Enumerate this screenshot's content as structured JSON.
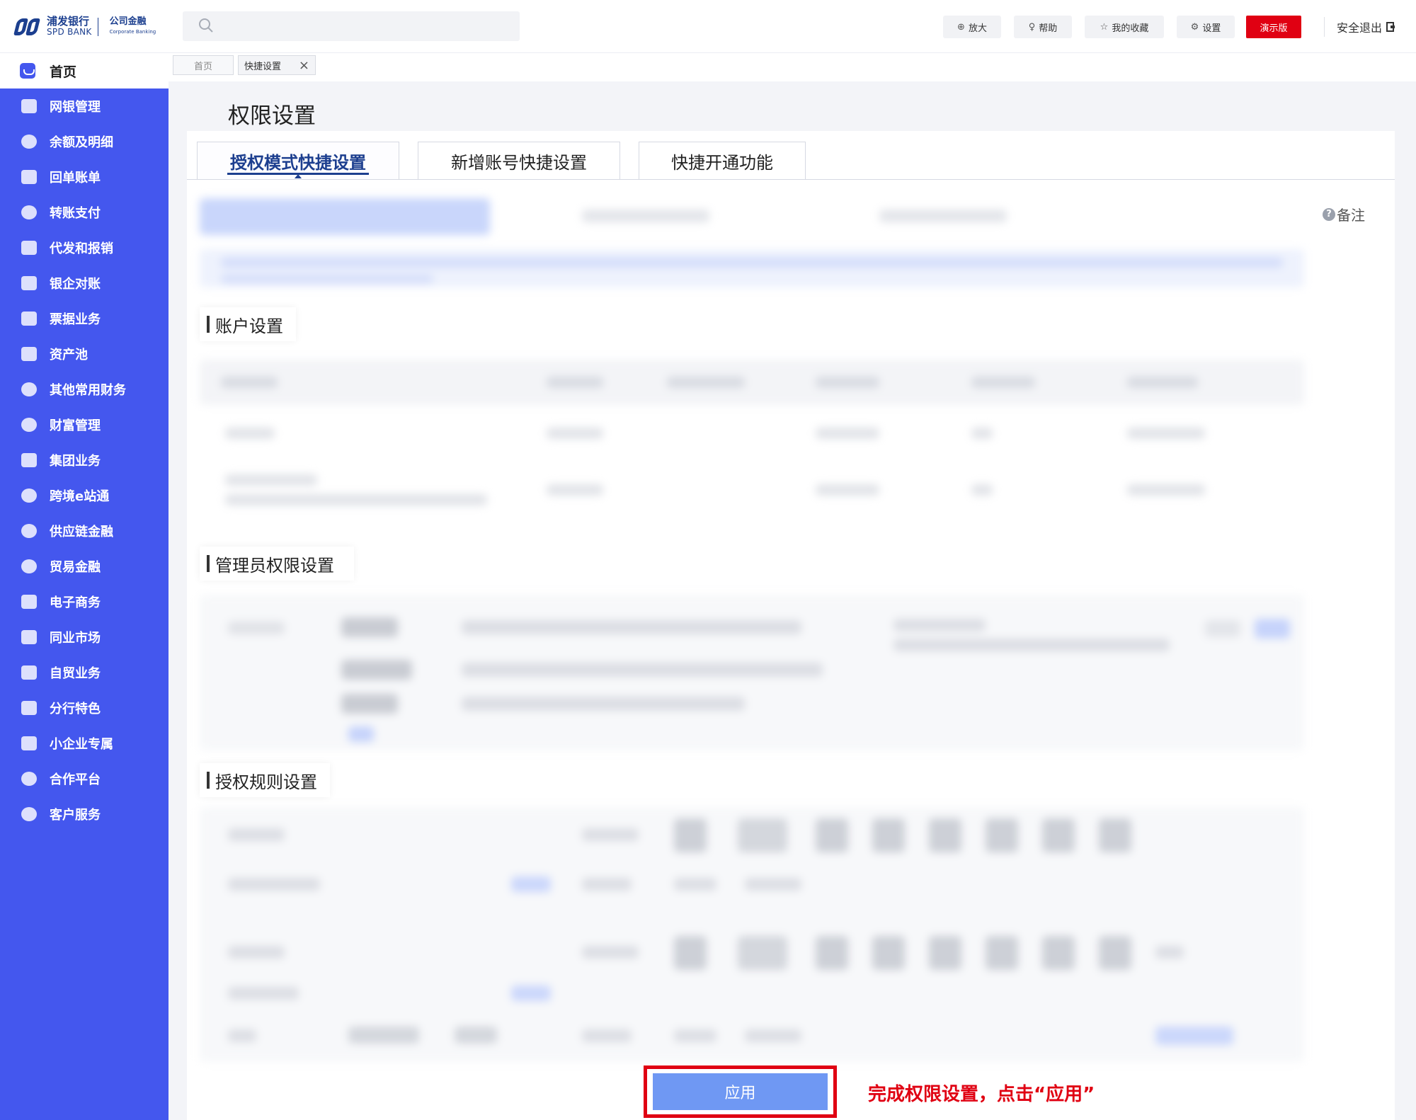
{
  "header": {
    "logo_cn": "浦发银行",
    "logo_en": "SPD BANK",
    "logo_sub_cn": "公司金融",
    "logo_sub_en": "Corporate Banking",
    "search_placeholder": "",
    "tools": [
      {
        "label": "放大",
        "icon": "zoom-in-icon"
      },
      {
        "label": "帮助",
        "icon": "lightbulb-icon"
      },
      {
        "label": "我的收藏",
        "icon": "star-icon"
      },
      {
        "label": "设置",
        "icon": "gear-icon"
      }
    ],
    "demo_label": "演示版",
    "logout_label": "安全退出",
    "demo_color": "#e00012"
  },
  "sidebar": {
    "home_label": "首页",
    "accent": "#4457ee",
    "items": [
      "网银管理",
      "余额及明细",
      "回单账单",
      "转账支付",
      "代发和报销",
      "银企对账",
      "票据业务",
      "资产池",
      "其他常用财务",
      "财富管理",
      "集团业务",
      "跨境e站通",
      "供应链金融",
      "贸易金融",
      "电子商务",
      "同业市场",
      "自贸业务",
      "分行特色",
      "小企业专属",
      "合作平台",
      "客户服务"
    ]
  },
  "breadcrumbs": {
    "home": "首页",
    "active": "快捷设置"
  },
  "main": {
    "title": "权限设置",
    "tabs": [
      "授权模式快捷设置",
      "新增账号快捷设置",
      "快捷开通功能"
    ],
    "remark_label": "备注",
    "sections": [
      "账户设置",
      "管理员权限设置",
      "授权规则设置"
    ],
    "apply_label": "应用",
    "hint": "完成权限设置，点击“应用”",
    "hint_color": "#e00012"
  }
}
